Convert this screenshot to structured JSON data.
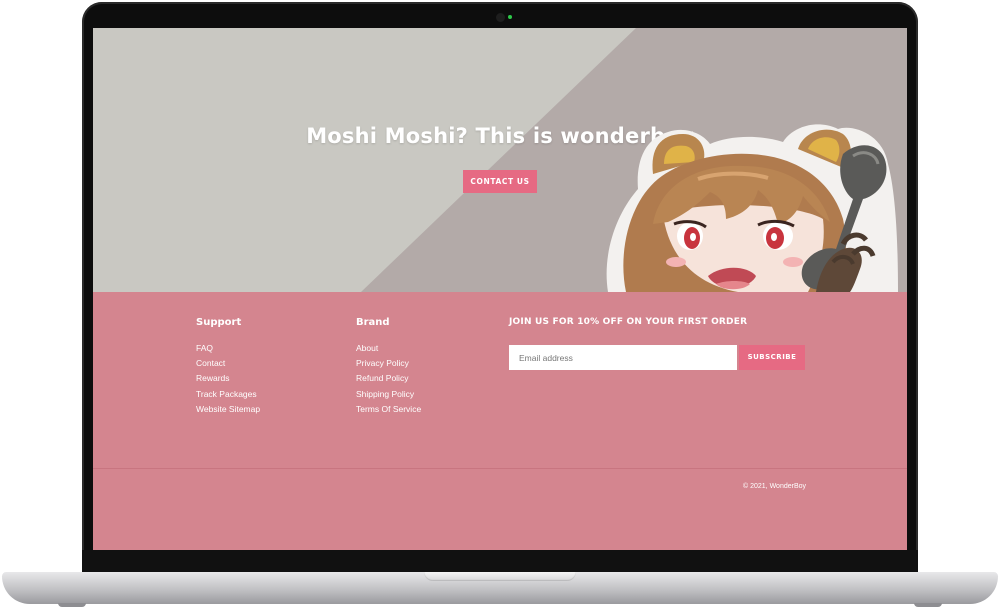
{
  "hero": {
    "title": "Moshi Moshi? This is wonderboy",
    "cta_label": "CONTACT US"
  },
  "footer": {
    "support": {
      "title": "Support",
      "links": [
        "FAQ",
        "Contact",
        "Rewards",
        "Track Packages",
        "Website Sitemap"
      ]
    },
    "brand": {
      "title": "Brand",
      "links": [
        "About",
        "Privacy Policy",
        "Refund Policy",
        "Shipping Policy",
        "Terms Of Service"
      ]
    },
    "newsletter": {
      "title": "JOIN US FOR 10% OFF ON YOUR FIRST ORDER",
      "email_placeholder": "Email address",
      "email_value": "",
      "subscribe_label": "SUBSCRIBE"
    },
    "copyright": "© 2021, WonderBoy"
  },
  "colors": {
    "accent": "#e66a83",
    "footer_bg": "#d4858f",
    "hero_bg_light": "#c9c8c2",
    "hero_bg_dark": "#b3aaa8"
  }
}
